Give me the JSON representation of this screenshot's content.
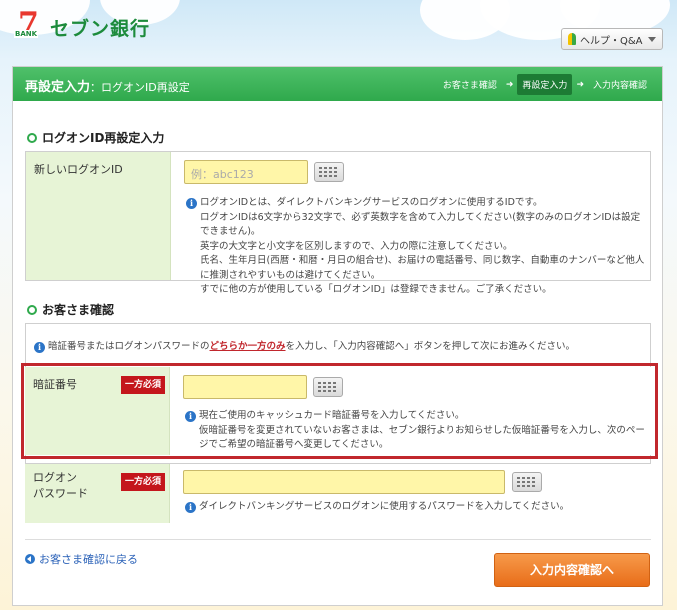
{
  "header": {
    "logo_mark": "7",
    "logo_bank": "BANK",
    "logo_text": "セブン銀行",
    "help_label": "ヘルプ・Q&A"
  },
  "title_bar": {
    "title": "再設定入力",
    "subtitle": "：ログオンID再設定",
    "steps": [
      "お客さま確認",
      "再設定入力",
      "入力内容確認"
    ],
    "active_step": 1
  },
  "section1": {
    "heading": "ログオンID再設定入力",
    "label": "新しいログオンID",
    "placeholder": "例：abc123",
    "notes": [
      "ログオンIDとは、ダイレクトバンキングサービスのログオンに使用するIDです。",
      "ログオンIDは6文字から32文字で、必ず英数字を含めて入力してください(数字のみのログオンIDは設定できません)。",
      "英字の大文字と小文字を区別しますので、入力の際に注意してください。",
      "氏名、生年月日(西暦・和暦・月日の組合せ)、お届けの電話番号、同じ数字、自動車のナンバーなど他人に推測されやすいものは避けてください。",
      "すでに他の方が使用している「ログオンID」は登録できません。ご了承ください。"
    ]
  },
  "section2": {
    "heading": "お客さま確認",
    "intro_before": "暗証番号またはログオンパスワードの",
    "intro_emph": "どちらか一方のみ",
    "intro_after": "を入力し、「入力内容確認へ」ボタンを押して次にお進みください。",
    "pin_label": "暗証番号",
    "pin_required": "一方必須",
    "pin_notes": [
      "現在ご使用のキャッシュカード暗証番号を入力してください。",
      "仮暗証番号を変更されていないお客さまは、セブン銀行よりお知らせした仮暗証番号を入力し、次のページでご希望の暗証番号へ変更してください。"
    ],
    "pw_label_1": "ログオン",
    "pw_label_2": "パスワード",
    "pw_required": "一方必須",
    "pw_note": "ダイレクトバンキングサービスのログオンに使用するパスワードを入力してください。"
  },
  "footer": {
    "back_label": "お客さま確認に戻る",
    "confirm_label": "入力内容確認へ"
  },
  "colors": {
    "brand_green": "#2fa94c",
    "label_bg": "#e7f4d6",
    "input_bg": "#fff6a8",
    "required_red": "#c4161c",
    "highlight_red": "#c1272d",
    "button_orange": "#e86d19"
  }
}
